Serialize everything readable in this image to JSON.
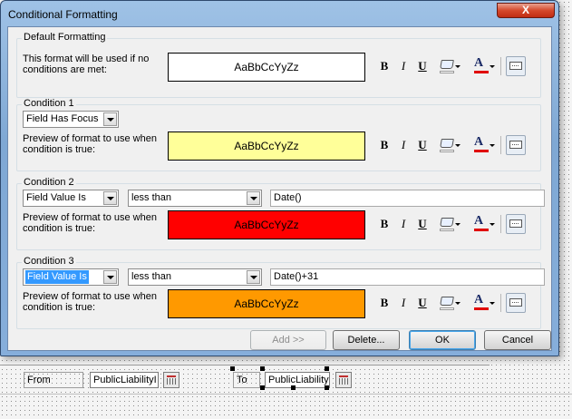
{
  "window": {
    "title": "Conditional Formatting",
    "close_glyph": "X"
  },
  "default_formatting": {
    "group_title": "Default Formatting",
    "description_line1": "This format will be used if no",
    "description_line2": "conditions are met:",
    "preview_text": "AaBbCcYyZz",
    "preview_bg": "#ffffff"
  },
  "condition1": {
    "group_title": "Condition 1",
    "type_value": "Field Has Focus",
    "description_line1": "Preview of format to use when",
    "description_line2": "condition is true:",
    "preview_text": "AaBbCcYyZz",
    "preview_bg": "#ffff99"
  },
  "condition2": {
    "group_title": "Condition 2",
    "type_value": "Field Value Is",
    "operator_value": "less than",
    "expression_value": "Date()",
    "description_line1": "Preview of format to use when",
    "description_line2": "condition is true:",
    "preview_text": "AaBbCcYyZz",
    "preview_bg": "#ff0000"
  },
  "condition3": {
    "group_title": "Condition 3",
    "type_value": "Field Value Is",
    "operator_value": "less than",
    "expression_value": "Date()+31",
    "description_line1": "Preview of format to use when",
    "description_line2": "condition is true:",
    "preview_text": "AaBbCcYyZz",
    "preview_bg": "#ff9900"
  },
  "toolbar": {
    "bold": "B",
    "italic": "I",
    "underline": "U",
    "font_color_letter": "A",
    "icons": [
      "bold-icon",
      "italic-icon",
      "underline-icon",
      "fill-color-icon",
      "font-color-icon",
      "enable-toggle-icon"
    ]
  },
  "buttons": {
    "add": "Add >>",
    "delete": "Delete...",
    "ok": "OK",
    "cancel": "Cancel"
  },
  "form_design": {
    "from_label": "From",
    "from_field": "PublicLiabilityI",
    "to_label": "To",
    "to_field": "PublicLiability"
  },
  "colors": {
    "title_bar": "#8fb6e0",
    "client_bg": "#f0f0f0",
    "close_red": "#c8391c",
    "font_color_bar": "#e00000",
    "selection": "#3399ff"
  }
}
